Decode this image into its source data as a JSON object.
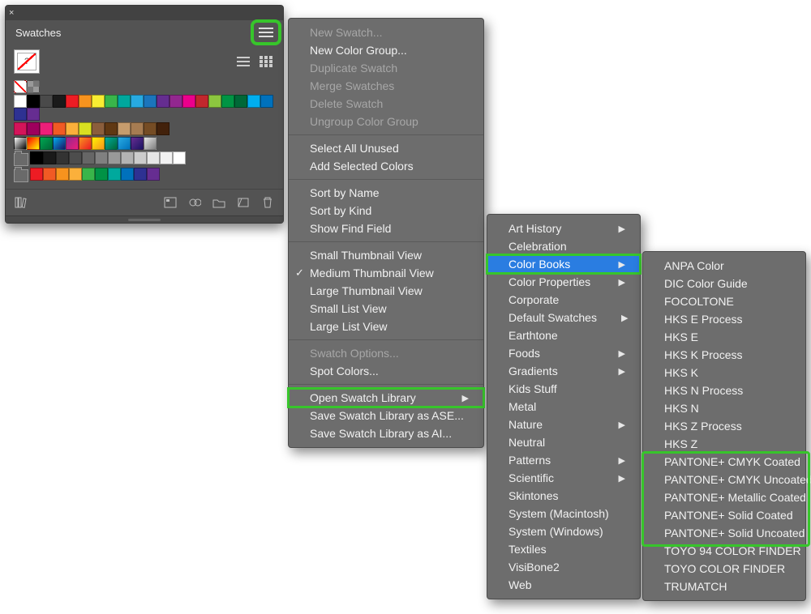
{
  "panel": {
    "title": "Swatches",
    "current_label": "?",
    "swatch_rows": [
      {
        "type": "special",
        "cells": [
          "none",
          "reg"
        ]
      },
      {
        "type": "colors",
        "colors": [
          "#ffffff",
          "#000000",
          "#4a4a4a",
          "#1a1a1a",
          "#ed1c24",
          "#f7931e",
          "#f9ed32",
          "#39b54a",
          "#00a79d",
          "#27aae1",
          "#1b75bc",
          "#652d90",
          "#92278f",
          "#ec008c",
          "#c1272d",
          "#8cc63f",
          "#009444",
          "#006837",
          "#00aeef",
          "#0071bc",
          "#2e3192",
          "#662d91"
        ]
      },
      {
        "type": "colors",
        "colors": [
          "#d4145a",
          "#9e005d",
          "#ed1e79",
          "#f15a24",
          "#fbb03b",
          "#d9e021",
          "#8b5e3c",
          "#603813",
          "#c69c6d",
          "#a67c52",
          "#754c24",
          "#42210b"
        ]
      },
      {
        "type": "gradients",
        "gradients": [
          [
            "#ffffff",
            "#000000"
          ],
          [
            "#ff0000",
            "#ffff00"
          ],
          [
            "#00a651",
            "#006837"
          ],
          [
            "#00aeef",
            "#1b1464"
          ],
          [
            "#93278f",
            "#ed1e79"
          ],
          [
            "#f7931e",
            "#ed1c24"
          ],
          [
            "#fff200",
            "#f7931e"
          ],
          [
            "#00a99d",
            "#006837"
          ],
          [
            "#29abe2",
            "#0071bc"
          ],
          [
            "#662d91",
            "#1b1464"
          ],
          [
            "#e6e6e6",
            "#808080"
          ]
        ]
      },
      {
        "type": "folder_colors",
        "colors": [
          "#000000",
          "#1a1a1a",
          "#333333",
          "#4d4d4d",
          "#666666",
          "#808080",
          "#999999",
          "#b3b3b3",
          "#cccccc",
          "#e6e6e6",
          "#f2f2f2",
          "#ffffff"
        ]
      },
      {
        "type": "folder_colors",
        "colors": [
          "#ed1c24",
          "#f15a24",
          "#f7931e",
          "#fbb03b",
          "#39b54a",
          "#009245",
          "#00a99d",
          "#0071bc",
          "#2e3192",
          "#662d91"
        ]
      }
    ],
    "footer_icons": [
      "library-icon",
      "show-kind-icon",
      "options-icon",
      "new-group-icon",
      "new-swatch-icon",
      "trash-icon"
    ]
  },
  "menu1": {
    "groups": [
      [
        {
          "label": "New Swatch...",
          "disabled": true
        },
        {
          "label": "New Color Group...",
          "disabled": false
        },
        {
          "label": "Duplicate Swatch",
          "disabled": true
        },
        {
          "label": "Merge Swatches",
          "disabled": true
        },
        {
          "label": "Delete Swatch",
          "disabled": true
        },
        {
          "label": "Ungroup Color Group",
          "disabled": true
        }
      ],
      [
        {
          "label": "Select All Unused"
        },
        {
          "label": "Add Selected Colors"
        }
      ],
      [
        {
          "label": "Sort by Name"
        },
        {
          "label": "Sort by Kind"
        },
        {
          "label": "Show Find Field"
        }
      ],
      [
        {
          "label": "Small Thumbnail View"
        },
        {
          "label": "Medium Thumbnail View",
          "checked": true
        },
        {
          "label": "Large Thumbnail View"
        },
        {
          "label": "Small List View"
        },
        {
          "label": "Large List View"
        }
      ],
      [
        {
          "label": "Swatch Options...",
          "disabled": true
        },
        {
          "label": "Spot Colors..."
        }
      ],
      [
        {
          "label": "Open Swatch Library",
          "submenu": true,
          "highlight": true
        },
        {
          "label": "Save Swatch Library as ASE..."
        },
        {
          "label": "Save Swatch Library as AI..."
        }
      ]
    ]
  },
  "menu2": {
    "items": [
      {
        "label": "Art History",
        "submenu": true
      },
      {
        "label": "Celebration"
      },
      {
        "label": "Color Books",
        "submenu": true,
        "selected": true,
        "highlight": true
      },
      {
        "label": "Color Properties",
        "submenu": true
      },
      {
        "label": "Corporate"
      },
      {
        "label": "Default Swatches",
        "submenu": true
      },
      {
        "label": "Earthtone"
      },
      {
        "label": "Foods",
        "submenu": true
      },
      {
        "label": "Gradients",
        "submenu": true
      },
      {
        "label": "Kids Stuff"
      },
      {
        "label": "Metal"
      },
      {
        "label": "Nature",
        "submenu": true
      },
      {
        "label": "Neutral"
      },
      {
        "label": "Patterns",
        "submenu": true
      },
      {
        "label": "Scientific",
        "submenu": true
      },
      {
        "label": "Skintones"
      },
      {
        "label": "System (Macintosh)"
      },
      {
        "label": "System (Windows)"
      },
      {
        "label": "Textiles"
      },
      {
        "label": "VisiBone2"
      },
      {
        "label": "Web"
      }
    ]
  },
  "menu3": {
    "items": [
      {
        "label": "ANPA Color"
      },
      {
        "label": "DIC Color Guide"
      },
      {
        "label": "FOCOLTONE"
      },
      {
        "label": "HKS E Process"
      },
      {
        "label": "HKS E"
      },
      {
        "label": "HKS K Process"
      },
      {
        "label": "HKS K"
      },
      {
        "label": "HKS N Process"
      },
      {
        "label": "HKS N"
      },
      {
        "label": "HKS Z Process"
      },
      {
        "label": "HKS Z"
      },
      {
        "label": "PANTONE+ CMYK Coated"
      },
      {
        "label": "PANTONE+ CMYK Uncoated"
      },
      {
        "label": "PANTONE+ Metallic Coated"
      },
      {
        "label": "PANTONE+ Solid Coated"
      },
      {
        "label": "PANTONE+ Solid Uncoated"
      },
      {
        "label": "TOYO 94 COLOR FINDER"
      },
      {
        "label": "TOYO COLOR FINDER"
      },
      {
        "label": "TRUMATCH"
      }
    ],
    "pantone_highlight_start": 11,
    "pantone_highlight_end": 15
  }
}
